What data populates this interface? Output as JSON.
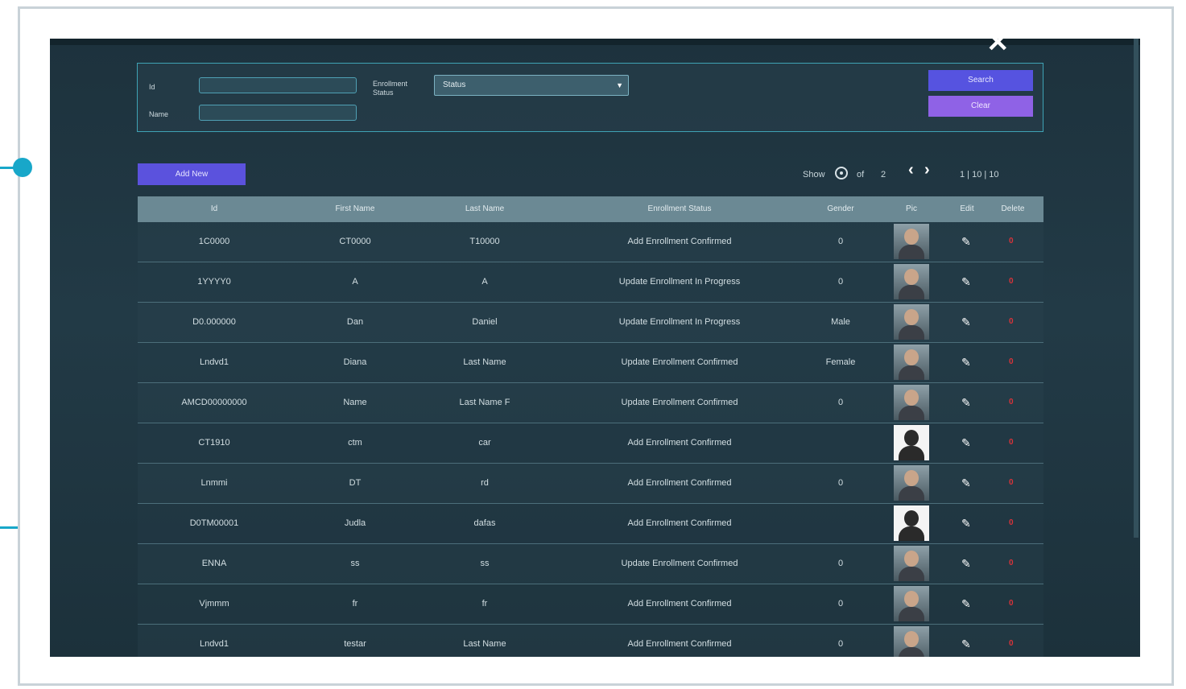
{
  "window": {
    "title": "",
    "close_icon": "close-icon"
  },
  "filters": {
    "id_label": "Id",
    "name_label": "Name",
    "id_value": "",
    "name_value": "",
    "status_label": "Enrollment Status",
    "status_value": "Status",
    "search_button": "Search",
    "clear_button": "Clear"
  },
  "toolbar": {
    "add_button": "Add New",
    "show_label": "Show",
    "of_label": "of",
    "page_total": "2",
    "range_text": "1 | 10 | 10"
  },
  "table": {
    "headers": [
      "Id",
      "First Name",
      "Last Name",
      "Enrollment Status",
      "Gender",
      "Pic",
      "Edit",
      "Delete"
    ],
    "rows": [
      {
        "id": "1C0000",
        "first": "CT0000",
        "last": "T10000",
        "status": "Add Enrollment Confirmed",
        "gender": "0",
        "photo": "man-1"
      },
      {
        "id": "1YYYY0",
        "first": "A",
        "last": "A",
        "status": "Update Enrollment In Progress",
        "gender": "0",
        "photo": "man-2"
      },
      {
        "id": "D0.000000",
        "first": "Dan",
        "last": "Daniel",
        "status": "Update Enrollment In Progress",
        "gender": "Male",
        "photo": "man-3"
      },
      {
        "id": "Lndvd1",
        "first": "Diana",
        "last": "Last Name",
        "status": "Update Enrollment Confirmed",
        "gender": "Female",
        "photo": "woman-1"
      },
      {
        "id": "AMCD00000000",
        "first": "Name",
        "last": "Last Name F",
        "status": "Update Enrollment Confirmed",
        "gender": "0",
        "photo": "man-4"
      },
      {
        "id": "CT1910",
        "first": "ctm",
        "last": "car",
        "status": "Add Enrollment Confirmed",
        "gender": "",
        "photo": "silhouette"
      },
      {
        "id": "Lnmmi",
        "first": "DT",
        "last": "rd",
        "status": "Add Enrollment Confirmed",
        "gender": "0",
        "photo": "man-5"
      },
      {
        "id": "D0TM00001",
        "first": "Judla",
        "last": "dafas",
        "status": "Add Enrollment Confirmed",
        "gender": "",
        "photo": "silhouette"
      },
      {
        "id": "ENNA",
        "first": "ss",
        "last": "ss",
        "status": "Update Enrollment Confirmed",
        "gender": "0",
        "photo": "man-6"
      },
      {
        "id": "Vjmmm",
        "first": "fr",
        "last": "fr",
        "status": "Add Enrollment Confirmed",
        "gender": "0",
        "photo": "man-7"
      },
      {
        "id": "Lndvd1",
        "first": "testar",
        "last": "Last Name",
        "status": "Add Enrollment Confirmed",
        "gender": "0",
        "photo": "man-8"
      }
    ],
    "edit_icon": "pencil-icon",
    "delete_icon": "delete-icon",
    "delete_glyph": "0"
  },
  "colors": {
    "background": "#1d323d",
    "accent_panel_border": "#3fa3b5",
    "search_button": "#5653e0",
    "clear_button": "#8f62e6",
    "add_button": "#5b52dd",
    "delete_red": "#d8333a"
  }
}
